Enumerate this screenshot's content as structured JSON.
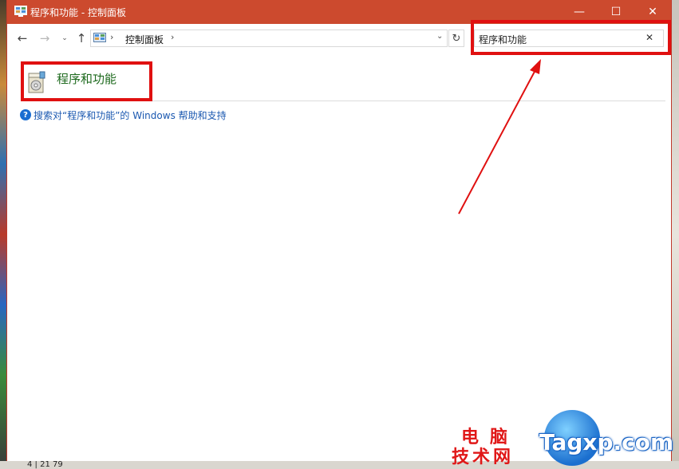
{
  "window": {
    "title": "程序和功能 - 控制面板",
    "controls": {
      "minimize": "—",
      "maximize": "☐",
      "close": "✕"
    }
  },
  "nav": {
    "back": "←",
    "forward": "→",
    "recent": "⌄",
    "up": "↑",
    "address": {
      "separator_1": "›",
      "crumb": "控制面板",
      "separator_2": "›",
      "dropdown": "⌄"
    },
    "refresh": "↻",
    "search": {
      "value": "程序和功能",
      "clear": "✕"
    }
  },
  "results": {
    "title": "程序和功能",
    "help_icon": "?",
    "help_link": "搜索对“程序和功能”的 Windows 帮助和支持"
  },
  "watermark": {
    "line1": "电脑",
    "line2": "技术网",
    "site": "Tagxp.com"
  },
  "desktop": {
    "bottom_text": "4 | 21 79"
  },
  "colors": {
    "titlebar": "#cc4a2e",
    "highlight": "#e01010",
    "result_title": "#1e6a1e",
    "link": "#1a58b0"
  }
}
